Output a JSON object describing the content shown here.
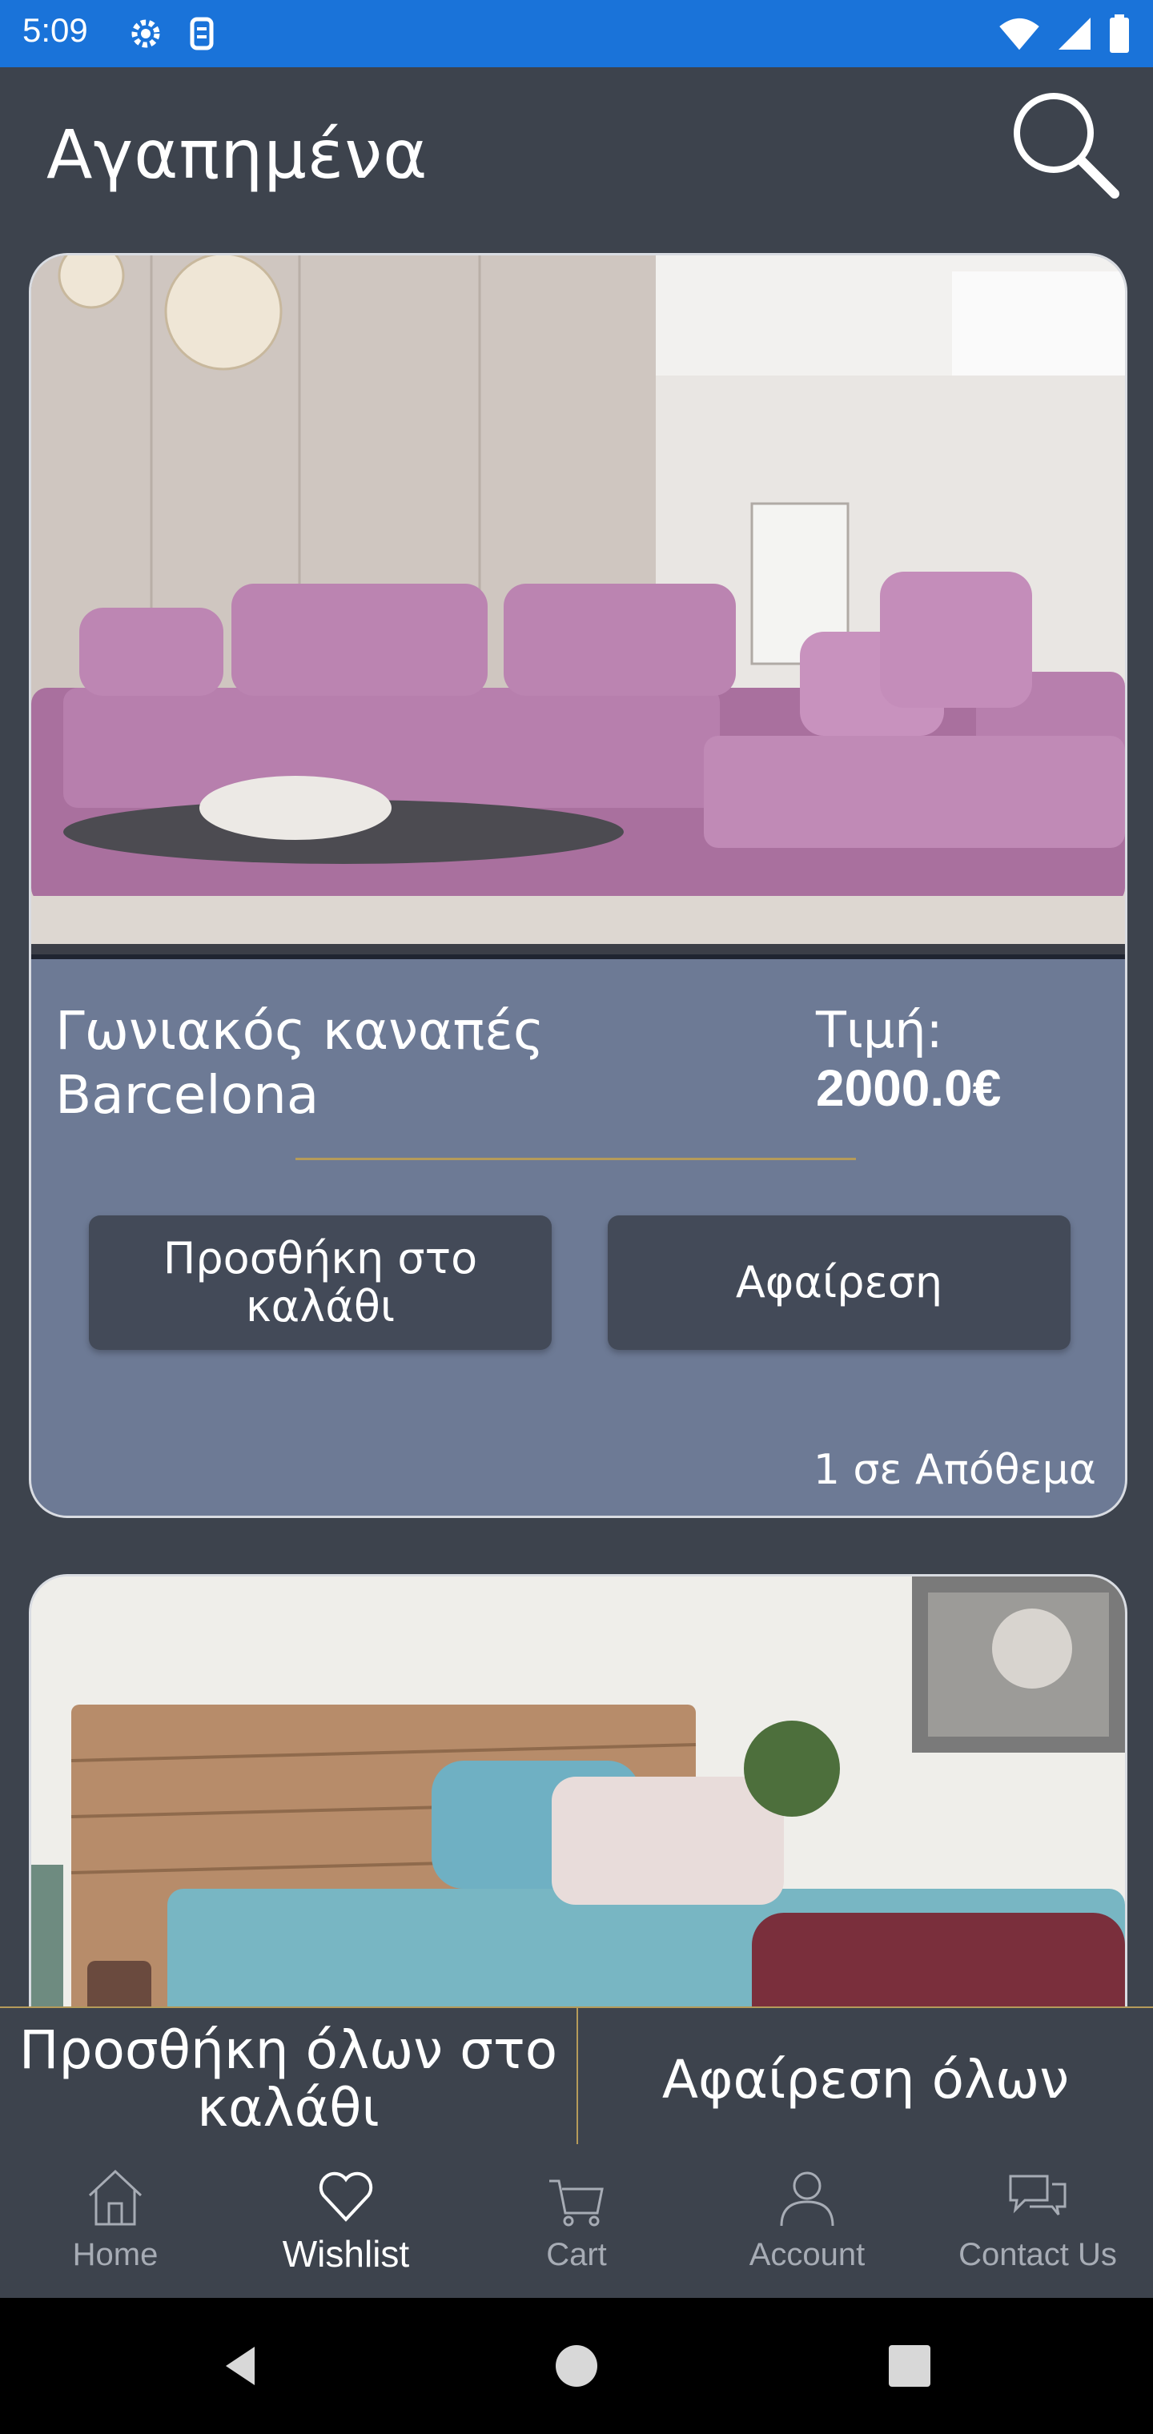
{
  "status_bar": {
    "time": "5:09"
  },
  "header": {
    "title": "Αγαπημένα"
  },
  "wishlist": [
    {
      "name": "Γωνιακός καναπές Barcelona",
      "price_label": "Τιμή:",
      "price": "2000.0€",
      "add_to_cart_label": "Προσθήκη στο καλάθι",
      "remove_label": "Αφαίρεση",
      "stock_text": "1 σε Απόθεμα"
    }
  ],
  "actions": {
    "add_all_label": "Προσθήκη όλων στο καλάθι",
    "remove_all_label": "Αφαίρεση όλων"
  },
  "nav": {
    "items": [
      {
        "label": "Home",
        "icon": "home-icon"
      },
      {
        "label": "Wishlist",
        "icon": "heart-icon",
        "active": true
      },
      {
        "label": "Cart",
        "icon": "cart-icon"
      },
      {
        "label": "Account",
        "icon": "account-icon"
      },
      {
        "label": "Contact Us",
        "icon": "chat-icon"
      }
    ]
  },
  "colors": {
    "status_bar": "#1a73d9",
    "background": "#3d434d",
    "card_info": "#6d7a95",
    "button": "#434a58",
    "accent_gold": "#b59b5a"
  }
}
